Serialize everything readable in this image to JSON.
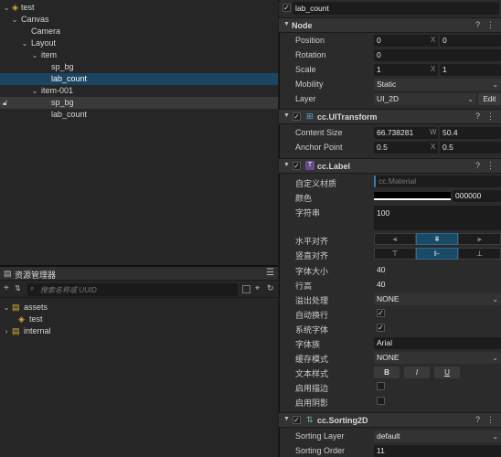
{
  "hierarchy": {
    "nodes": [
      {
        "label": "test",
        "arrow": "⌄"
      },
      {
        "label": "Canvas",
        "arrow": "⌄"
      },
      {
        "label": "Camera",
        "arrow": ""
      },
      {
        "label": "Layout",
        "arrow": "⌄"
      },
      {
        "label": "item",
        "arrow": "⌄"
      },
      {
        "label": "sp_bg",
        "arrow": ""
      },
      {
        "label": "lab_count",
        "arrow": ""
      },
      {
        "label": "item-001",
        "arrow": "⌄"
      },
      {
        "label": "sp_bg",
        "arrow": ""
      },
      {
        "label": "lab_count",
        "arrow": ""
      }
    ]
  },
  "assets": {
    "title": "资源管理器",
    "search_placeholder": "搜索名称或 UUID",
    "tree": [
      {
        "label": "assets",
        "arrow": "⌄"
      },
      {
        "label": "test",
        "arrow": ""
      },
      {
        "label": "internal",
        "arrow": "›"
      }
    ]
  },
  "inspector": {
    "node_name": "lab_count",
    "node_section": {
      "title": "Node",
      "position": {
        "label": "Position",
        "x": "0",
        "y": "0"
      },
      "rotation": {
        "label": "Rotation",
        "z": "0"
      },
      "scale": {
        "label": "Scale",
        "x": "1",
        "y": "1"
      },
      "mobility": {
        "label": "Mobility",
        "value": "Static"
      },
      "layer": {
        "label": "Layer",
        "value": "UI_2D",
        "edit": "Edit"
      }
    },
    "ui_transform": {
      "title": "cc.UITransform",
      "content_size": {
        "label": "Content Size",
        "w": "66.738281",
        "h": "50.4"
      },
      "anchor_point": {
        "label": "Anchor Point",
        "x": "0.5",
        "y": "0.5"
      }
    },
    "label": {
      "title": "cc.Label",
      "custom_material": {
        "label": "自定义材质",
        "value": "cc.Material"
      },
      "color": {
        "label": "颜色",
        "value": "000000"
      },
      "string": {
        "label": "字符串",
        "value": "100"
      },
      "h_align": {
        "label": "水平对齐"
      },
      "v_align": {
        "label": "竖直对齐"
      },
      "font_size": {
        "label": "字体大小",
        "value": "40"
      },
      "line_height": {
        "label": "行高",
        "value": "40"
      },
      "overflow": {
        "label": "溢出处理",
        "value": "NONE"
      },
      "wrap": {
        "label": "自动换行",
        "checked": "✓"
      },
      "system_font": {
        "label": "系统字体",
        "checked": "✓"
      },
      "font_family": {
        "label": "字体族",
        "value": "Arial"
      },
      "cache_mode": {
        "label": "缓存模式",
        "value": "NONE"
      },
      "text_style": {
        "label": "文本样式",
        "bold": "B",
        "italic": "I",
        "underline": "U"
      },
      "outline": {
        "label": "启用描边"
      },
      "shadow": {
        "label": "启用阴影"
      }
    },
    "sorting": {
      "title": "cc.Sorting2D",
      "sorting_layer": {
        "label": "Sorting Layer",
        "value": "default"
      },
      "sorting_order": {
        "label": "Sorting Order",
        "value": "11"
      }
    }
  },
  "colors": {
    "selection": "#1b4560",
    "accent_blue": "#1b4a66",
    "prefab_orange": "#e8a33d",
    "folder_yellow": "#e0b43a"
  }
}
